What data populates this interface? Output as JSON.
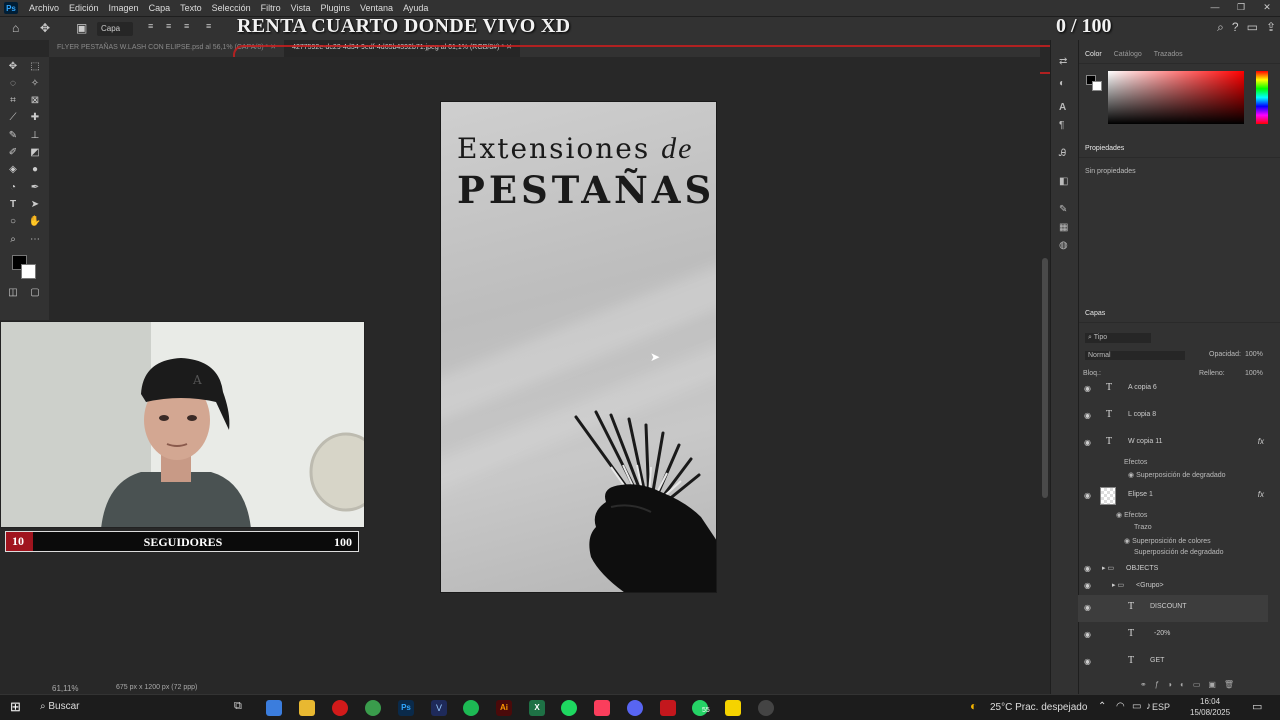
{
  "menu": {
    "app_icon": "Ps",
    "items": [
      "Archivo",
      "Edición",
      "Imagen",
      "Capa",
      "Texto",
      "Selección",
      "Filtro",
      "Vista",
      "Plugins",
      "Ventana",
      "Ayuda"
    ]
  },
  "window_controls": {
    "min": "—",
    "max": "❐",
    "close": "✕"
  },
  "options_bar": {
    "layer_select": "Capa"
  },
  "overlay": {
    "title": "RENTA CUARTO DONDE VIVO XD",
    "counter": "0 / 100"
  },
  "tabs": [
    {
      "label": "FLYER PESTAÑAS W.LASH CON ELIPSE.psd al 56,1% (CAPA/8) *",
      "active": false
    },
    {
      "label": "4277592e-dc29-4d34-9edf-4d65b4392b71.jpeg al 61,1% (RGB/8#) *",
      "active": true
    }
  ],
  "document": {
    "line1": "Extensiones",
    "line1_italic": "de",
    "line2": "PESTAÑAS"
  },
  "webcam_bar": {
    "current": "10",
    "label": "SEGUIDORES",
    "goal": "100",
    "progress": 0.1
  },
  "status": {
    "zoom": "61,11%",
    "size": "675 px x 1200 px (72 ppp)"
  },
  "panels": {
    "color_tabs": [
      "Color",
      "Catálogo",
      "Trazados"
    ],
    "properties_title": "Propiedades",
    "properties_text": "Sin propiedades",
    "layers_title": "Capas",
    "filter_label": "Tipo",
    "blend_mode": "Normal",
    "opacity_label": "Opacidad:",
    "opacity_value": "100%",
    "lock_label": "Bloq.:",
    "fill_label": "Relleno:",
    "fill_value": "100%"
  },
  "layers": [
    {
      "name": "A copia 6",
      "type": "text",
      "fx": false
    },
    {
      "name": "L copia 8",
      "type": "text",
      "fx": false
    },
    {
      "name": "W copia 11",
      "type": "text",
      "fx": true
    },
    {
      "name": "Efectos",
      "type": "sub"
    },
    {
      "name": "Superposición de degradado",
      "type": "sub2"
    },
    {
      "name": "Elipse 1",
      "type": "shape",
      "fx": true
    },
    {
      "name": "Efectos",
      "type": "sub"
    },
    {
      "name": "Trazo",
      "type": "sub2"
    },
    {
      "name": "Superposición de colores",
      "type": "sub2"
    },
    {
      "name": "Superposición de degradado",
      "type": "sub2"
    },
    {
      "name": "OBJECTS",
      "type": "group"
    },
    {
      "name": "<Grupo>",
      "type": "group2"
    },
    {
      "name": "DISCOUNT",
      "type": "text",
      "fx": false
    },
    {
      "name": "-20%",
      "type": "text",
      "fx": false
    },
    {
      "name": "GET",
      "type": "text",
      "fx": false
    }
  ],
  "taskbar": {
    "search": "Buscar",
    "weather": "25°C  Prac. despejado",
    "lang": "ESP",
    "time": "16:04",
    "date": "15/08/2025",
    "whatsapp_badge": "55"
  },
  "colors": {
    "fg": "#000000",
    "bg": "#ffffff",
    "accent_red": "#a0141e"
  }
}
